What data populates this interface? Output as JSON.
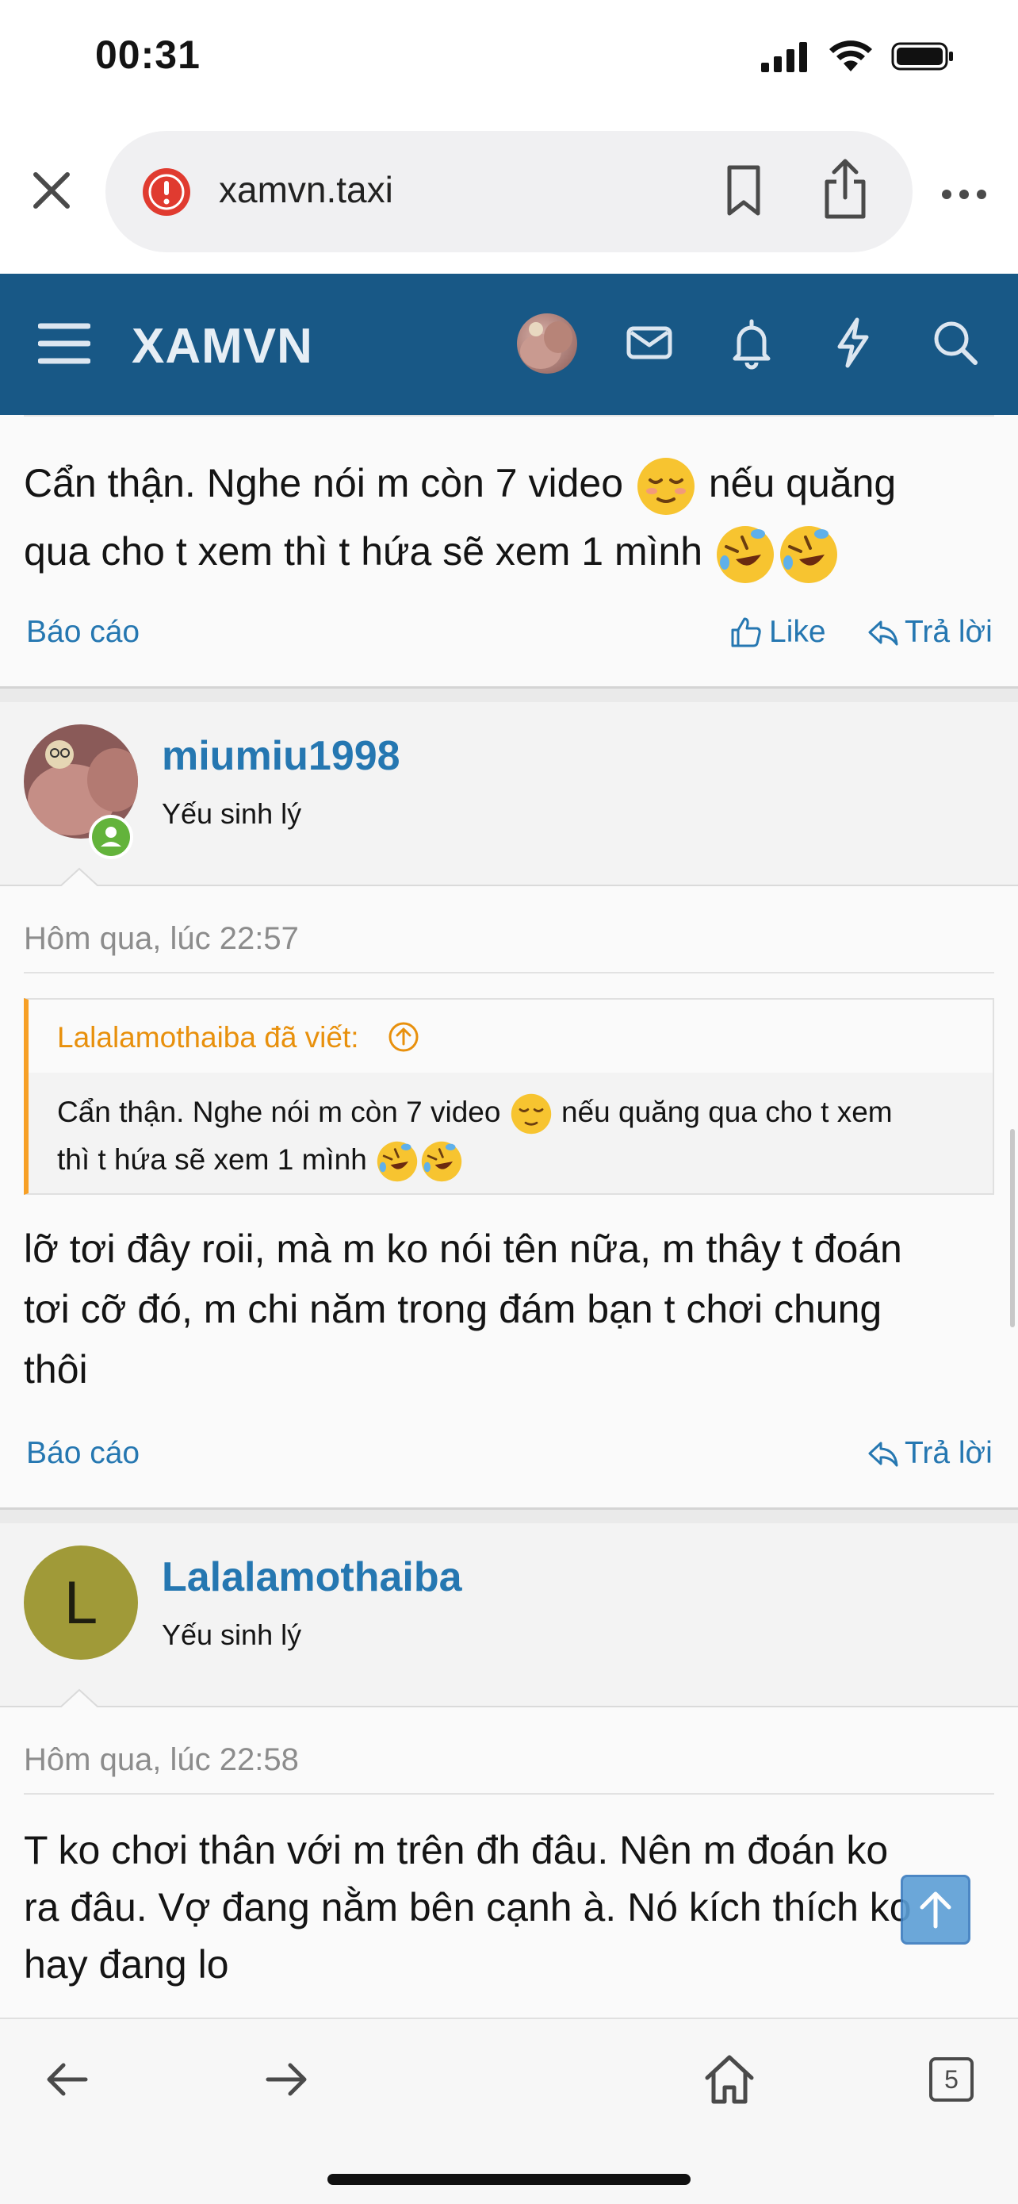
{
  "status_bar": {
    "time": "00:31"
  },
  "browser": {
    "url": "xamvn.taxi",
    "tab_count": "5"
  },
  "site": {
    "logo": "XAMVN"
  },
  "first_post": {
    "text_line1": "Cẩn thận. Nghe nói m còn 7 video",
    "text_line1_after": "nếu quăng",
    "text_line2": "qua cho t xem thì t hứa sẽ xem 1 mình",
    "report": "Báo cáo",
    "like": "Like",
    "reply": "Trả lời"
  },
  "second_post": {
    "username": "miumiu1998",
    "user_title": "Yếu sinh lý",
    "date": "Hôm qua, lúc 22:57",
    "quote_author": "Lalalamothaiba đã viết:",
    "quote_line1": "Cẩn thận. Nghe nói m còn 7 video",
    "quote_line1_after": "nếu quăng qua cho t xem",
    "quote_line2": "thì t hứa sẽ xem 1 mình",
    "line1": "lỡ tơi đây roii, mà m ko nói tên nữa, m thây t đoán",
    "line2": "tơi cỡ đó, m chi năm trong đám bạn t chơi chung",
    "line3": "thôi",
    "report": "Báo cáo",
    "reply": "Trả lời"
  },
  "third_post": {
    "avatar_letter": "L",
    "avatar_color": "#a09a38",
    "username": "Lalalamothaiba",
    "user_title": "Yếu sinh lý",
    "date": "Hôm qua, lúc 22:58",
    "line1": "T ko chơi thân với m trên đh đâu. Nên m đoán ko",
    "line2": "ra đâu. Vợ đang nằm bên cạnh à. Nó kích thích ko",
    "line3": "hay đang lo"
  },
  "colors": {
    "header": "#185886",
    "link": "#2577b1",
    "quote_accent": "#f7a026"
  }
}
